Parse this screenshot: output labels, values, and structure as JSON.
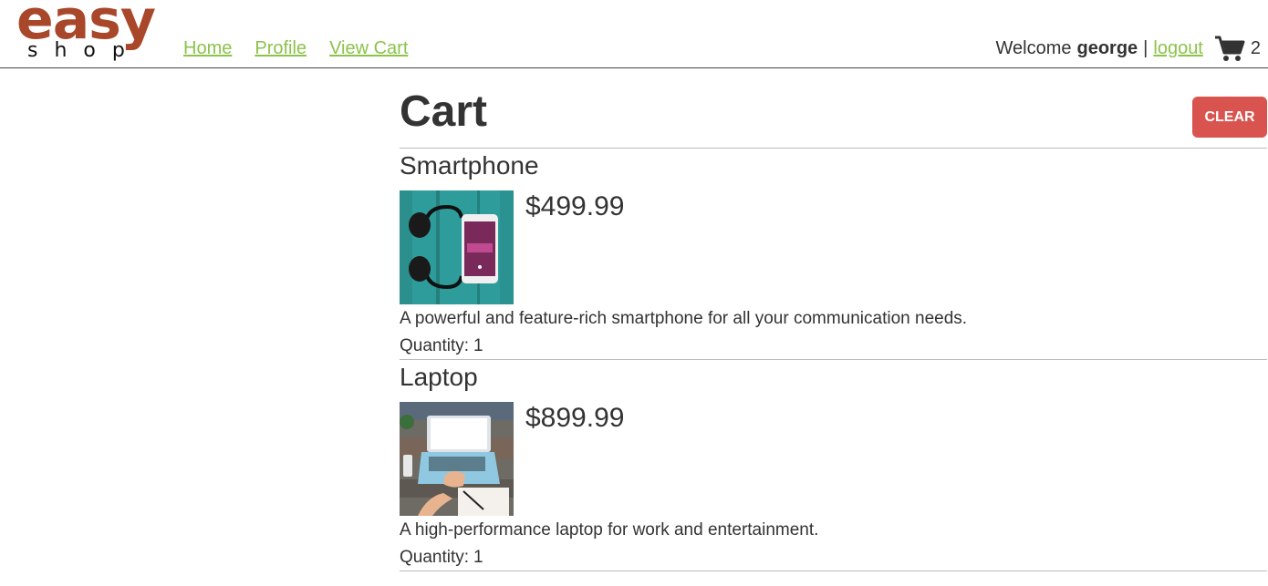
{
  "logo": {
    "top": "easy",
    "bottom": "shop"
  },
  "nav": {
    "home": "Home",
    "profile": "Profile",
    "view_cart": "View Cart"
  },
  "user": {
    "welcome": "Welcome",
    "name": "george",
    "separator": "|",
    "logout": "logout",
    "cart_count": "2"
  },
  "cart": {
    "title": "Cart",
    "clear_label": "CLEAR"
  },
  "items": [
    {
      "name": "Smartphone",
      "price": "$499.99",
      "description": "A powerful and feature-rich smartphone for all your communication needs.",
      "quantity_label": "Quantity:",
      "quantity": "1",
      "image": "headphones-and-phone-on-teal-wood"
    },
    {
      "name": "Laptop",
      "price": "$899.99",
      "description": "A high-performance laptop for work and entertainment.",
      "quantity_label": "Quantity:",
      "quantity": "1",
      "image": "laptop-on-wooden-desk"
    }
  ],
  "colors": {
    "logo_brown": "#a9472a",
    "link_green": "#8bc34a",
    "clear_red": "#d9534f",
    "text": "#333333"
  }
}
